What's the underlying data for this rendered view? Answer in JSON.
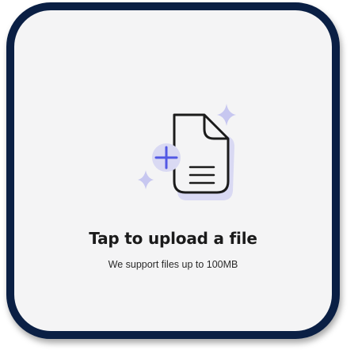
{
  "upload": {
    "title": "Tap to upload a file",
    "subtitle": "We support files up to 100MB",
    "icon": "file-upload-icon"
  },
  "colors": {
    "border": "#0a1f44",
    "card_bg": "#f4f4f5",
    "accent": "#5258e4",
    "accent_soft": "#d9d9f3",
    "sparkle": "#c7c7f0"
  }
}
